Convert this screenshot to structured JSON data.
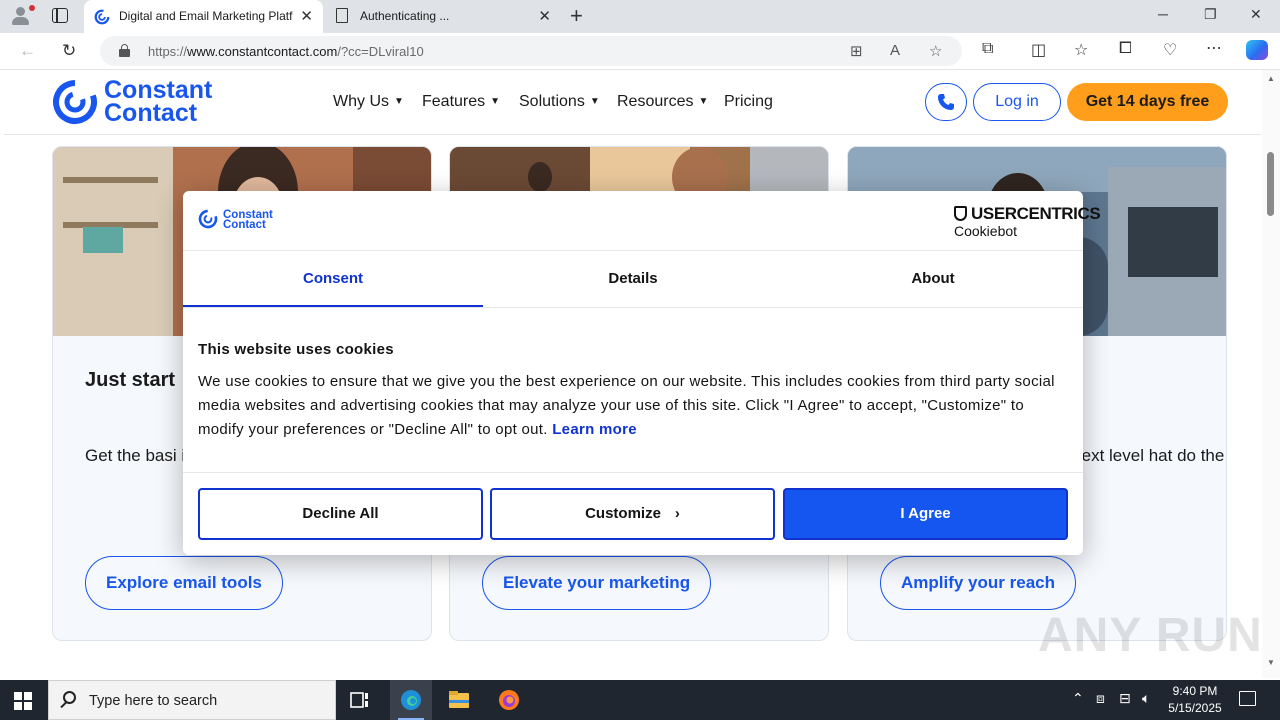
{
  "browser": {
    "tabs": [
      {
        "title": "Digital and Email Marketing Platf",
        "active": true
      },
      {
        "title": "Authenticating ...",
        "active": false
      }
    ],
    "url": {
      "prefix": "https://",
      "host": "www.constantcontact.com",
      "path": "/?cc=DLviral10"
    }
  },
  "site": {
    "logo_line1": "Constant",
    "logo_line2": "Contact",
    "nav": [
      {
        "label": "Why Us",
        "has_dropdown": true
      },
      {
        "label": "Features",
        "has_dropdown": true
      },
      {
        "label": "Solutions",
        "has_dropdown": true
      },
      {
        "label": "Resources",
        "has_dropdown": true
      },
      {
        "label": "Pricing",
        "has_dropdown": false
      }
    ],
    "login_label": "Log in",
    "trial_label": "Get 14 days free",
    "brand_blue": "#1856ed",
    "accent_orange": "#ff9e1b"
  },
  "cards": [
    {
      "heading": "Just start",
      "desc": "Get the basi into email co clicks.",
      "cta": "Explore email tools"
    },
    {
      "heading": "",
      "desc": "",
      "cta": "Elevate your marketing"
    },
    {
      "heading": "",
      "desc": "e next level hat do the",
      "cta": "Amplify your reach"
    }
  ],
  "cookie_dialog": {
    "logo_line1": "Constant",
    "logo_line2": "Contact",
    "provider_brand": "USERCENTRICS",
    "provider_product": "Cookiebot",
    "tabs": [
      {
        "label": "Consent",
        "active": true
      },
      {
        "label": "Details",
        "active": false
      },
      {
        "label": "About",
        "active": false
      }
    ],
    "heading": "This website uses cookies",
    "body": "We use cookies to ensure that we give you the best experience on our website. This includes cookies from third party social media websites and advertising cookies that may analyze your use of this site. Click \"I Agree\" to accept, \"Customize\" to modify your preferences or \"Decline All\" to opt out.",
    "learn_more": "Learn more",
    "buttons": {
      "decline": "Decline All",
      "customize": "Customize",
      "agree": "I Agree"
    },
    "primary_color": "#1656f0"
  },
  "watermark": "ANY RUN",
  "taskbar": {
    "search_placeholder": "Type here to search",
    "time": "9:40 PM",
    "date": "5/15/2025"
  }
}
